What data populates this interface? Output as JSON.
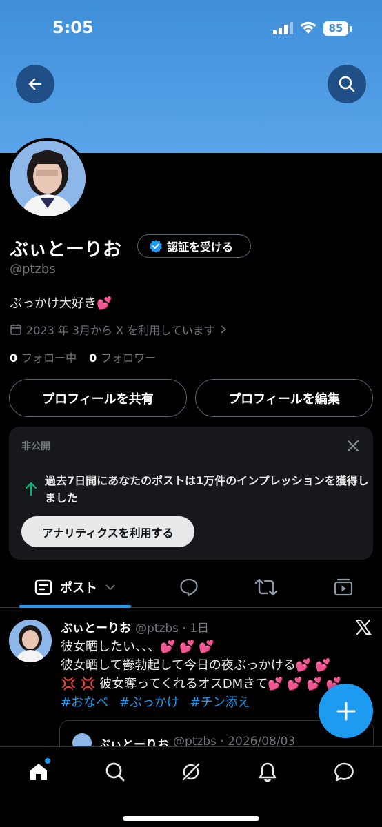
{
  "status_bar": {
    "time": "5:05",
    "battery": "85"
  },
  "profile": {
    "name": "ぶぃとーりお",
    "verify_label": "認証を受ける",
    "handle": "@ptzbs",
    "bio": "ぶっかけ大好き💕",
    "joined": "2023 年 3月から X を利用しています",
    "following_count": "0",
    "following_label": "フォロー中",
    "followers_count": "0",
    "followers_label": "フォロワー",
    "share_label": "プロフィールを共有",
    "edit_label": "プロフィールを編集"
  },
  "private_card": {
    "label": "非公開",
    "message": "過去7日間にあなたのポストは1万件のインプレッションを獲得しました",
    "button": "アナリティクスを利用する"
  },
  "tabs": {
    "posts_label": "ポスト"
  },
  "post": {
    "name": "ぶぃとーりお",
    "meta": "@ptzbs · 1日",
    "lines": [
      "彼女晒したい、、、💕 💕 💕",
      "彼女晒して鬱勃起して今日の夜ぶっかける💕 💕",
      "💢 💢 彼女奪ってくれるオスDMきて💕 💕 💕 💕"
    ],
    "hashtags": [
      "#おなペ",
      "#ぶっかけ",
      "#チン添え"
    ],
    "quote_name": "ぶぃとーりお",
    "quote_meta": "@ptzbs · 2026/08/03"
  },
  "colors": {
    "accent": "#1d9bf0",
    "banner": "#4a98e2",
    "success": "#00ba7c"
  },
  "icons": [
    "back-arrow-icon",
    "search-icon",
    "verified-badge-icon",
    "calendar-icon",
    "chevron-right-icon",
    "close-icon",
    "arrow-up-icon",
    "posts-icon",
    "chevron-down-icon",
    "reply-icon",
    "repost-icon",
    "media-icon",
    "x-logo-icon",
    "plus-icon",
    "home-icon",
    "explore-icon",
    "grok-icon",
    "bell-icon",
    "messages-icon"
  ]
}
